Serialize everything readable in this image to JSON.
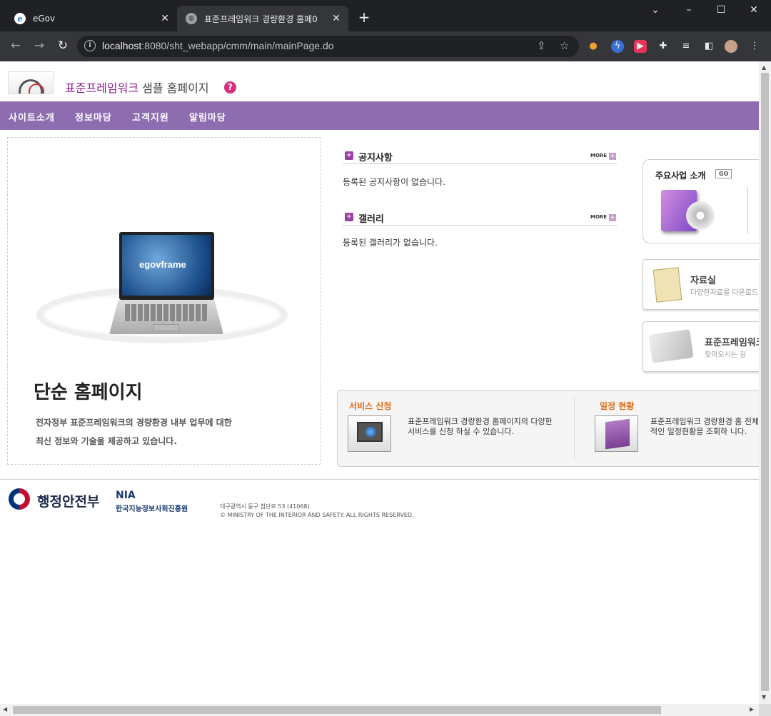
{
  "browser": {
    "tabs": [
      {
        "title": "eGov",
        "favicon": "egov-e-icon"
      },
      {
        "title": "표준프레임워크 경량환경 홈페0",
        "favicon": "globe-icon"
      }
    ],
    "new_tab": "+",
    "url_host": "localhost",
    "url_rest": ":8080/sht_webapp/cmm/main/mainPage.do"
  },
  "header": {
    "title_highlight": "표준프레임워크",
    "title_rest": " 샘플 홈페이지",
    "help": "?"
  },
  "gnb": [
    "사이트소개",
    "정보마당",
    "고객지원",
    "알림마당"
  ],
  "hero": {
    "brand": "egovframe",
    "title": "단순 홈페이지",
    "desc_line1": "전자정부 표준프레임워크의 경량환경 내부 업무에 대한",
    "desc_line2": "최신 정보와 기술을 제공하고 있습니다."
  },
  "notice": {
    "title": "공지사항",
    "more": "MORE",
    "empty": "등록된 공지사항이 없습니다."
  },
  "gallery": {
    "title": "갤러리",
    "more": "MORE",
    "empty": "등록된 갤러리가 없습니다."
  },
  "business": {
    "title": "주요사업 소개",
    "go": "GO"
  },
  "archive": {
    "title": "자료실",
    "sub": "다양한자료를 다운로드"
  },
  "directions": {
    "title": "표준프레임워크",
    "sub": "찾아오시는 길"
  },
  "service": {
    "title": "서비스 신청",
    "desc": "표준프레임워크 경량환경 홈페이지의 다양한 서비스를 신청 하실 수 있습니다."
  },
  "schedule": {
    "title": "일정 현황",
    "desc": "표준프레임워크 경량환경 홈 전체적인 일정현황을 조회하 니다."
  },
  "footer": {
    "ministry": "행정안전부",
    "nia": "NIA",
    "nia_full": "한국지능정보사회진흥원",
    "address": "대구광역시 동구 첨단로 53 (41068)",
    "copyright": "© MINISTRY OF THE INTERIOR AND SAFETY. ALL RIGHTS RESERVED."
  },
  "colors": {
    "nav_bg": "#8d6db0",
    "accent": "#8e1e8e",
    "orange": "#e06b12"
  }
}
